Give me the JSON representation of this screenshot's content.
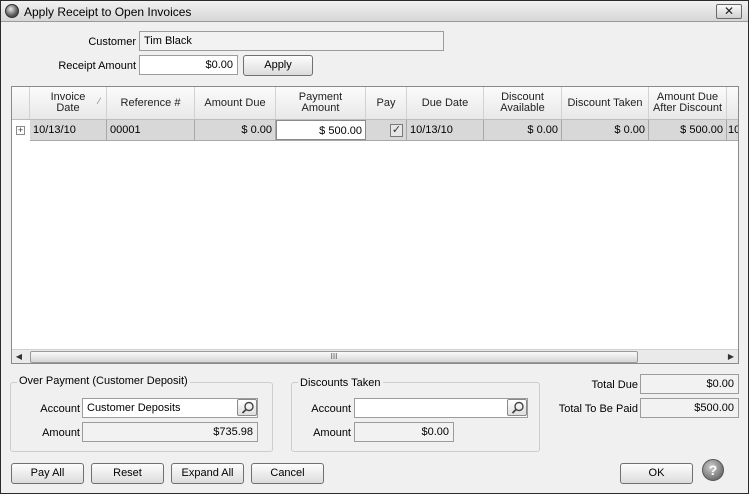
{
  "window": {
    "title": "Apply Receipt to Open Invoices",
    "close_glyph": "✕"
  },
  "form": {
    "customer_label": "Customer",
    "customer_value": "Tim Black",
    "receipt_amount_label": "Receipt Amount",
    "receipt_amount_value": "$0.00",
    "apply_label": "Apply"
  },
  "grid": {
    "columns": [
      "Invoice\nDate",
      "Reference #",
      "Amount Due",
      "Payment\nAmount",
      "Pay",
      "Due Date",
      "Discount\nAvailable",
      "Discount Taken",
      "Amount Due\nAfter Discount"
    ],
    "rows": [
      {
        "invoice_date": "10/13/10",
        "reference": "00001",
        "amount_due": "$ 0.00",
        "payment_amount": "$ 500.00",
        "pay": true,
        "due_date": "10/13/10",
        "discount_available": "$ 0.00",
        "discount_taken": "$ 0.00",
        "amount_due_after_discount": "$ 500.00",
        "overflow": "10"
      }
    ],
    "scroll_thumb_grip": "III"
  },
  "overpayment": {
    "title": "Over Payment (Customer Deposit)",
    "account_label": "Account",
    "account_value": "Customer Deposits",
    "amount_label": "Amount",
    "amount_value": "$735.98"
  },
  "discounts": {
    "title": "Discounts Taken",
    "account_label": "Account",
    "account_value": "",
    "amount_label": "Amount",
    "amount_value": "$0.00"
  },
  "totals": {
    "total_due_label": "Total Due",
    "total_due_value": "$0.00",
    "total_paid_label": "Total To Be Paid",
    "total_paid_value": "$500.00"
  },
  "buttons": {
    "pay_all": "Pay All",
    "reset": "Reset",
    "expand_all": "Expand All",
    "cancel": "Cancel",
    "ok": "OK"
  },
  "colors": {
    "row_selected": "#d8d8d8",
    "window_bg": "#f0f0f0"
  }
}
